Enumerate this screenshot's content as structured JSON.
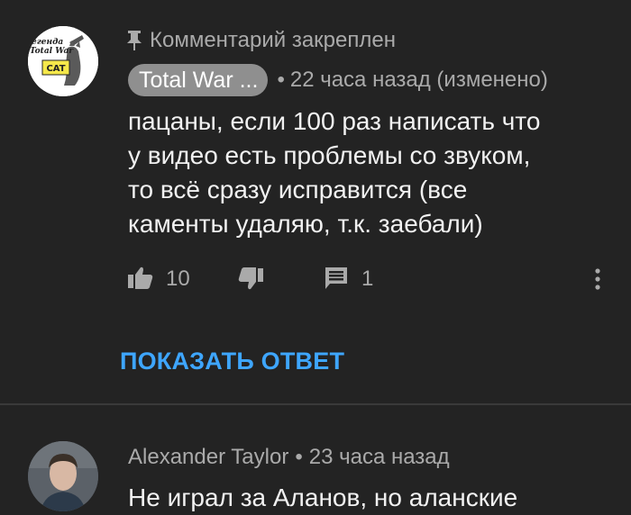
{
  "comments": [
    {
      "pinned_label": "Комментарий закреплен",
      "author": "Total War ...",
      "time": "22 часа назад (изменено)",
      "avatar_text": {
        "line1": "егенда",
        "line2": "Total War",
        "line3": "CAT"
      },
      "text": [
        "пацаны, если 100 раз написать что",
        "у видео есть проблемы со звуком,",
        "то всё сразу исправится (все",
        "каменты удаляю, т.к. заебали)"
      ],
      "likes": "10",
      "replies": "1",
      "show_reply_label": "ПОКАЗАТЬ ОТВЕТ"
    },
    {
      "author": "Alexander Taylor",
      "time": "23 часа назад",
      "text": "Не играл за Аланов, но аланские"
    }
  ],
  "icons": {
    "pin": "pin-icon",
    "like": "thumb-up-icon",
    "dislike": "thumb-down-icon",
    "reply": "reply-comment-icon",
    "more": "more-vertical-icon"
  },
  "colors": {
    "background": "#232323",
    "text": "#f1f1f1",
    "secondary": "#aaaaaa",
    "link": "#3ea6ff",
    "author_chip": "#8f8f8f"
  }
}
